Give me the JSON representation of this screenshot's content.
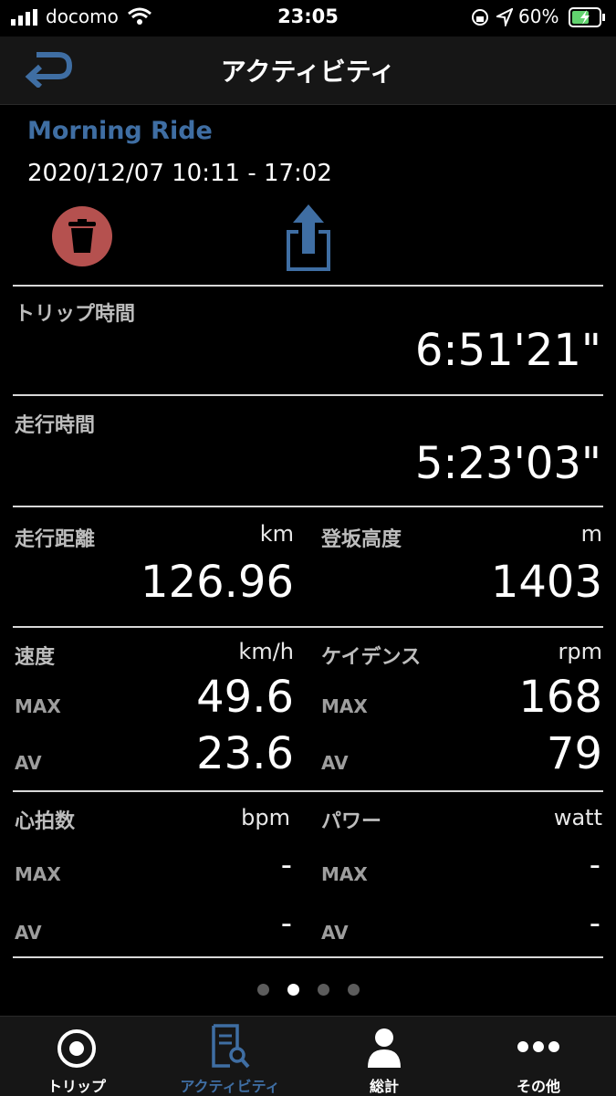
{
  "status": {
    "carrier": "docomo",
    "time": "23:05",
    "battery": "60%"
  },
  "header": {
    "title": "アクティビティ"
  },
  "ride": {
    "name": "Morning Ride",
    "date": "2020/12/07 10:11 - 17:02"
  },
  "trip_time": {
    "label": "トリップ時間",
    "value": "6:51'21\""
  },
  "riding_time": {
    "label": "走行時間",
    "value": "5:23'03\""
  },
  "distance": {
    "label": "走行距離",
    "unit": "km",
    "value": "126.96"
  },
  "climb": {
    "label": "登坂高度",
    "unit": "m",
    "value": "1403"
  },
  "speed": {
    "label": "速度",
    "unit": "km/h",
    "max_label": "MAX",
    "max": "49.6",
    "av_label": "AV",
    "av": "23.6"
  },
  "cadence": {
    "label": "ケイデンス",
    "unit": "rpm",
    "max_label": "MAX",
    "max": "168",
    "av_label": "AV",
    "av": "79"
  },
  "heart": {
    "label": "心拍数",
    "unit": "bpm",
    "max_label": "MAX",
    "max": "-",
    "av_label": "AV",
    "av": "-"
  },
  "power": {
    "label": "パワー",
    "unit": "watt",
    "max_label": "MAX",
    "max": "-",
    "av_label": "AV",
    "av": "-"
  },
  "tabs": [
    {
      "label": "トリップ"
    },
    {
      "label": "アクティビティ"
    },
    {
      "label": "総計"
    },
    {
      "label": "その他"
    }
  ],
  "colors": {
    "accent": "#3f6ea3",
    "delete": "#b5514f"
  }
}
